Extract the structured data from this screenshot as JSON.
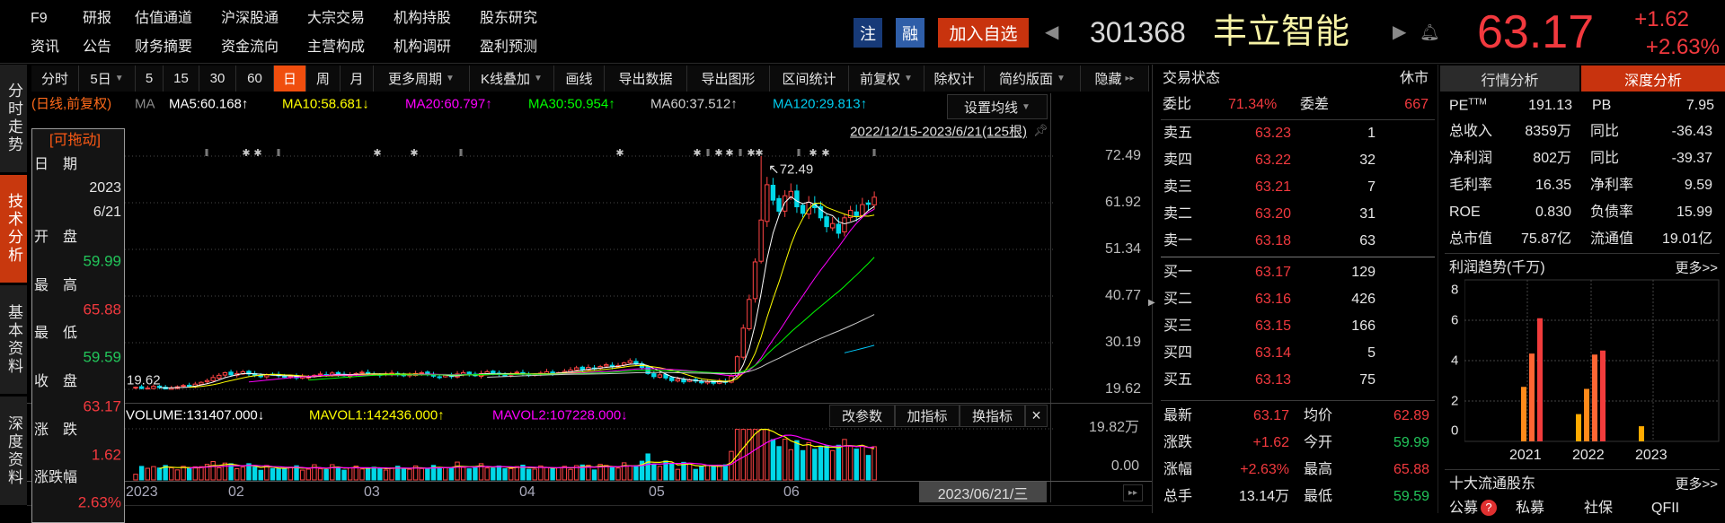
{
  "header": {
    "menu_row1": [
      "F9",
      "研报",
      "估值通道",
      "沪深股通",
      "大宗交易",
      "机构持股",
      "股东研究"
    ],
    "menu_row2": [
      "资讯",
      "公告",
      "财务摘要",
      "资金流向",
      "主营构成",
      "机构调研",
      "盈利预测"
    ],
    "badge_zhu": "注",
    "badge_rong": "融",
    "add_watchlist": "加入自选",
    "stock_code": "301368",
    "stock_name": "丰立智能",
    "price": "63.17",
    "change": "+1.62",
    "change_pct": "+2.63%"
  },
  "side_tabs": [
    "分时走势",
    "技术分析",
    "基本资料",
    "深度资料"
  ],
  "toolbar": [
    "分时",
    "5日",
    "5",
    "15",
    "30",
    "60",
    "日",
    "周",
    "月",
    "更多周期",
    "K线叠加",
    "画线",
    "导出数据",
    "导出图形",
    "区间统计",
    "前复权",
    "除权计",
    "简约版面",
    "隐藏"
  ],
  "ma_legend": {
    "mode": "(日线,前复权)",
    "ma": "MA",
    "ma5": "MA5:60.168↑",
    "ma10": "MA10:58.681↓",
    "ma20": "MA20:60.797↑",
    "ma30": "MA30:50.954↑",
    "ma60": "MA60:37.512↑",
    "ma120": "MA120:29.813↑",
    "set_ma": "设置均线",
    "range": "2022/12/15-2023/6/21(125根)"
  },
  "info_panel": {
    "drag": "[可拖动]",
    "date_label": "日　期",
    "year": "2023",
    "date": "6/21",
    "open_label": "开　盘",
    "open": "59.99",
    "high_label": "最　高",
    "high": "65.88",
    "low_label": "最　低",
    "low": "59.59",
    "close_label": "收　盘",
    "close": "63.17",
    "chg_label": "涨　跌",
    "chg": "1.62",
    "pct_label": "涨跌幅",
    "pct": "2.63%"
  },
  "volume_panel": {
    "volume": "VOLUME:131407.000↓",
    "mavol1": "MAVOL1:142436.000↑",
    "mavol2": "MAVOL2:107228.000↓",
    "buttons": [
      "改参数",
      "加指标",
      "换指标"
    ],
    "axis_top": "19.82万",
    "axis_bottom": "0.00",
    "x_labels": [
      "2023",
      "02",
      "03",
      "04",
      "05",
      "06"
    ],
    "cursor_date": "2023/06/21/三"
  },
  "chart_data": {
    "type": "candlestick",
    "title": "301368 丰立智能 日线",
    "y_axis_range": [
      19.62,
      72.49
    ],
    "y_ticks": [
      "72.49",
      "61.92",
      "51.34",
      "40.77",
      "30.19",
      "19.62"
    ],
    "min_label": "19.62",
    "max_label": "↖72.49",
    "high_bar_index": 105,
    "high_value": 72.49,
    "closes": [
      20.1,
      19.8,
      19.9,
      20.3,
      20.0,
      19.7,
      19.9,
      20.2,
      20.5,
      20.4,
      20.8,
      21.2,
      21.6,
      22.3,
      22.8,
      23.4,
      22.9,
      23.2,
      23.6,
      23.1,
      22.8,
      22.5,
      22.9,
      23.0,
      22.7,
      22.4,
      22.6,
      22.2,
      22.5,
      22.4,
      22.8,
      23.1,
      22.9,
      23.3,
      23.0,
      22.7,
      22.9,
      23.2,
      23.5,
      23.2,
      23.0,
      22.8,
      23.1,
      23.3,
      23.0,
      22.7,
      22.9,
      23.2,
      23.4,
      23.0,
      22.6,
      22.4,
      22.8,
      22.5,
      23.1,
      23.4,
      23.0,
      22.7,
      23.2,
      23.6,
      23.3,
      23.0,
      22.8,
      23.2,
      23.5,
      23.1,
      22.8,
      23.0,
      23.3,
      23.6,
      23.2,
      23.4,
      23.7,
      24.0,
      24.5,
      24.1,
      24.6,
      24.3,
      24.8,
      25.2,
      24.7,
      25.0,
      25.6,
      26.1,
      25.4,
      24.6,
      23.2,
      22.5,
      22.9,
      22.2,
      21.6,
      21.9,
      21.3,
      21.8,
      21.5,
      21.1,
      21.4,
      21.0,
      21.6,
      21.2,
      22.6,
      27.0,
      33.5,
      40.0,
      48.5,
      58.0,
      66.0,
      62.5,
      60.0,
      63.5,
      64.5,
      61.0,
      59.5,
      62.0,
      60.8,
      58.5,
      56.5,
      57.2,
      55.0,
      58.5,
      60.2,
      59.0,
      61.5,
      61.55,
      63.17
    ],
    "ma_periods": [
      5,
      10,
      20,
      30,
      60,
      120
    ],
    "ma_colors": [
      "#ffffff",
      "#ffff00",
      "#ff00ff",
      "#00ff00",
      "#c8c8c8",
      "#00ccff"
    ],
    "volume_axis_max": 19.82,
    "up_color": "#ff4444",
    "down_color": "#00d8e8"
  },
  "order_book": {
    "status_label": "交易状态",
    "status": "休市",
    "ratio_label": "委比",
    "ratio": "71.34%",
    "diff_label": "委差",
    "diff": "667",
    "asks": [
      {
        "label": "卖五",
        "price": "63.23",
        "vol": "1"
      },
      {
        "label": "卖四",
        "price": "63.22",
        "vol": "32"
      },
      {
        "label": "卖三",
        "price": "63.21",
        "vol": "7"
      },
      {
        "label": "卖二",
        "price": "63.20",
        "vol": "31"
      },
      {
        "label": "卖一",
        "price": "63.18",
        "vol": "63"
      }
    ],
    "bids": [
      {
        "label": "买一",
        "price": "63.17",
        "vol": "129"
      },
      {
        "label": "买二",
        "price": "63.16",
        "vol": "426"
      },
      {
        "label": "买三",
        "price": "63.15",
        "vol": "166"
      },
      {
        "label": "买四",
        "price": "63.14",
        "vol": "5"
      },
      {
        "label": "买五",
        "price": "63.13",
        "vol": "75"
      }
    ],
    "stats": [
      {
        "l1": "最新",
        "v1": "63.17",
        "l2": "均价",
        "v2": "62.89"
      },
      {
        "l1": "涨跌",
        "v1": "+1.62",
        "l2": "今开",
        "v2": "59.99"
      },
      {
        "l1": "涨幅",
        "v1": "+2.63%",
        "l2": "最高",
        "v2": "65.88"
      },
      {
        "l1": "总手",
        "v1": "13.14万",
        "l2": "最低",
        "v2": "59.59"
      }
    ]
  },
  "right_panel": {
    "tabs": [
      "行情分析",
      "深度分析"
    ],
    "pe_label": "PE",
    "pe_sup": "TTM",
    "pe": "191.13",
    "pb_label": "PB",
    "pb": "7.95",
    "rows": [
      {
        "l1": "总收入",
        "v1": "8359万",
        "l2": "同比",
        "v2": "-36.43"
      },
      {
        "l1": "净利润",
        "v1": "802万",
        "l2": "同比",
        "v2": "-39.37"
      },
      {
        "l1": "毛利率",
        "v1": "16.35",
        "l2": "净利率",
        "v2": "9.59"
      },
      {
        "l1": "ROE",
        "v1": "0.830",
        "l2": "负债率",
        "v2": "15.99"
      },
      {
        "l1": "总市值",
        "v1": "75.87亿",
        "l2": "流通值",
        "v2": "19.01亿"
      }
    ],
    "profit_title": "利润趋势(千万)",
    "more": "更多>>",
    "profit_trend": {
      "y_ticks": [
        "8",
        "6",
        "4",
        "2",
        "0"
      ],
      "y_max": 8,
      "quarter_colors": [
        "#ffaa00",
        "#ff8a1a",
        "#ff6633",
        "#f23c3c"
      ],
      "groups": [
        {
          "year": "2021",
          "values": [
            null,
            2.7,
            4.35,
            6.1
          ]
        },
        {
          "year": "2022",
          "values": [
            1.35,
            2.6,
            4.3,
            4.5
          ]
        },
        {
          "year": "2023",
          "values": [
            0.75
          ]
        }
      ]
    },
    "holders_title": "十大流通股东",
    "holders_more": "更多>>",
    "holder_tabs": [
      "公募",
      "私募",
      "社保",
      "QFII"
    ]
  }
}
